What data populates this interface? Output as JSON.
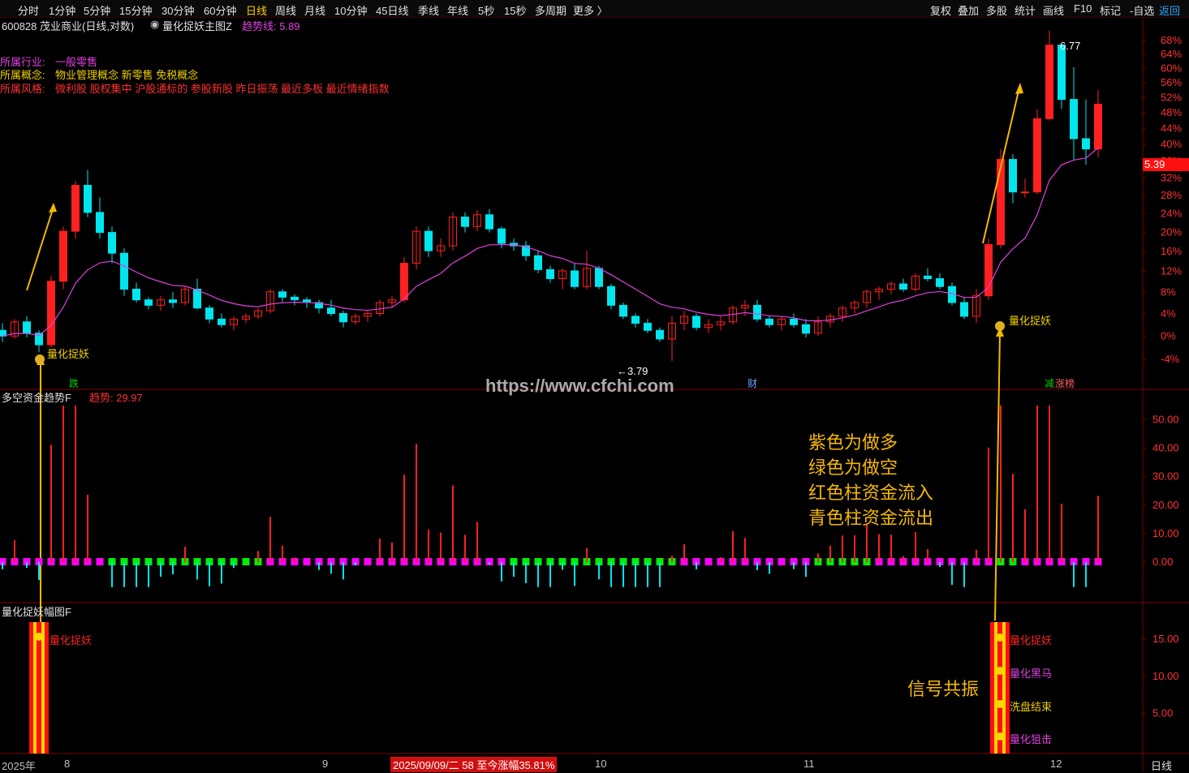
{
  "periods": [
    {
      "label": "分时",
      "active": false
    },
    {
      "label": "1分钟",
      "active": false
    },
    {
      "label": "5分钟",
      "active": false
    },
    {
      "label": "15分钟",
      "active": false
    },
    {
      "label": "30分钟",
      "active": false
    },
    {
      "label": "60分钟",
      "active": false
    },
    {
      "label": "日线",
      "active": true
    },
    {
      "label": "周线",
      "active": false
    },
    {
      "label": "月线",
      "active": false
    },
    {
      "label": "10分钟",
      "active": false
    },
    {
      "label": "45日线",
      "active": false
    },
    {
      "label": "季线",
      "active": false
    },
    {
      "label": "年线",
      "active": false
    },
    {
      "label": "5秒",
      "active": false
    },
    {
      "label": "15秒",
      "active": false
    },
    {
      "label": "多周期",
      "active": false
    },
    {
      "label": "更多 〉",
      "active": false
    }
  ],
  "toolbar_right": [
    "复权",
    "叠加",
    "多股",
    "统计",
    "画线",
    "F10",
    "标记",
    "-自选",
    "返回"
  ],
  "header": {
    "stock": "600828 茂业商业(日线,对数)",
    "indicator_name": "量化捉妖主图Z",
    "trend_label": "趋势线: 5.89"
  },
  "stock_info": {
    "industry_label": "所属行业:",
    "industry": "一般零售",
    "concept_label": "所属概念:",
    "concept": "物业管理概念 新零售 免税概念",
    "style_label": "所属风格:",
    "style": "微利股 股权集中 沪股通标的 参股新股 昨日振荡 最近多板 最近情绪指数"
  },
  "panel2": {
    "name": "多空资金趋势F",
    "value_label": "趋势: 29.97"
  },
  "panel3": {
    "name": "量化捉妖幅图F"
  },
  "annotations": {
    "signal_label": "量化捉妖",
    "high_label": "6.77",
    "low_label": "←3.79",
    "price_tag": "5.39",
    "watermark": "https://www.cfchi.com",
    "markers": [
      "跌",
      "财",
      "减",
      "涨榜"
    ],
    "legend_lines": [
      "紫色为做多",
      "绿色为做空",
      "红色柱资金流入",
      "青色柱资金流出"
    ],
    "resonance": "信号共振",
    "panel3_signals": [
      "量化捉妖",
      "量化黑马",
      "洗盘结束",
      "量化狙击"
    ]
  },
  "bottom_axis": {
    "labels": [
      "2025年",
      "8",
      "9",
      "10",
      "11",
      "12"
    ],
    "status": "2025/09/09/二 58 至今涨幅35.81%",
    "period": "日线"
  },
  "yaxis_main": [
    "68%",
    "64%",
    "60%",
    "56%",
    "52%",
    "48%",
    "44%",
    "40%",
    "36%",
    "32%",
    "28%",
    "24%",
    "20%",
    "16%",
    "12%",
    "8%",
    "4%",
    "0%",
    "-4%"
  ],
  "yaxis_p2": [
    "50.00",
    "40.00",
    "30.00",
    "20.00",
    "10.00",
    "0.00"
  ],
  "yaxis_p3": [
    "15.00",
    "10.00",
    "5.00"
  ],
  "colors": {
    "up": "#ff2020",
    "down": "#00e5ee",
    "trend": "#e040e0",
    "long": "#ff00ff",
    "short": "#00ee00",
    "grid": "#800000",
    "yellow": "#ffd700"
  },
  "chart_data": {
    "type": "candlestick",
    "x": [],
    "candles": [
      [
        4.0,
        4.05,
        3.92,
        3.96
      ],
      [
        3.96,
        4.08,
        3.94,
        4.06
      ],
      [
        4.06,
        4.1,
        3.95,
        3.98
      ],
      [
        3.98,
        4.0,
        3.85,
        3.9
      ],
      [
        3.9,
        4.4,
        3.88,
        4.36
      ],
      [
        4.36,
        4.8,
        4.3,
        4.76
      ],
      [
        4.76,
        5.2,
        4.7,
        5.16
      ],
      [
        5.16,
        5.3,
        4.88,
        4.92
      ],
      [
        4.92,
        5.05,
        4.7,
        4.75
      ],
      [
        4.75,
        4.8,
        4.5,
        4.58
      ],
      [
        4.58,
        4.62,
        4.25,
        4.3
      ],
      [
        4.3,
        4.35,
        4.2,
        4.22
      ],
      [
        4.22,
        4.24,
        4.15,
        4.18
      ],
      [
        4.18,
        4.25,
        4.14,
        4.22
      ],
      [
        4.22,
        4.28,
        4.16,
        4.2
      ],
      [
        4.2,
        4.32,
        4.18,
        4.3
      ],
      [
        4.3,
        4.38,
        4.15,
        4.16
      ],
      [
        4.16,
        4.18,
        4.05,
        4.08
      ],
      [
        4.08,
        4.12,
        4.02,
        4.04
      ],
      [
        4.04,
        4.1,
        4.0,
        4.08
      ],
      [
        4.08,
        4.12,
        4.05,
        4.1
      ],
      [
        4.1,
        4.16,
        4.08,
        4.14
      ],
      [
        4.14,
        4.3,
        4.12,
        4.28
      ],
      [
        4.28,
        4.3,
        4.2,
        4.24
      ],
      [
        4.24,
        4.26,
        4.18,
        4.22
      ],
      [
        4.22,
        4.24,
        4.16,
        4.2
      ],
      [
        4.2,
        4.22,
        4.12,
        4.16
      ],
      [
        4.16,
        4.22,
        4.1,
        4.12
      ],
      [
        4.12,
        4.14,
        4.02,
        4.06
      ],
      [
        4.06,
        4.12,
        4.04,
        4.1
      ],
      [
        4.1,
        4.14,
        4.06,
        4.12
      ],
      [
        4.12,
        4.22,
        4.1,
        4.2
      ],
      [
        4.2,
        4.25,
        4.16,
        4.22
      ],
      [
        4.22,
        4.55,
        4.2,
        4.5
      ],
      [
        4.5,
        4.8,
        4.45,
        4.76
      ],
      [
        4.76,
        4.8,
        4.55,
        4.6
      ],
      [
        4.6,
        4.7,
        4.55,
        4.64
      ],
      [
        4.64,
        4.92,
        4.6,
        4.88
      ],
      [
        4.88,
        4.92,
        4.75,
        4.8
      ],
      [
        4.8,
        4.94,
        4.76,
        4.9
      ],
      [
        4.9,
        4.95,
        4.75,
        4.78
      ],
      [
        4.78,
        4.8,
        4.62,
        4.66
      ],
      [
        4.66,
        4.7,
        4.6,
        4.64
      ],
      [
        4.64,
        4.68,
        4.52,
        4.56
      ],
      [
        4.56,
        4.6,
        4.42,
        4.45
      ],
      [
        4.45,
        4.48,
        4.35,
        4.38
      ],
      [
        4.38,
        4.46,
        4.3,
        4.44
      ],
      [
        4.44,
        4.5,
        4.3,
        4.32
      ],
      [
        4.32,
        4.6,
        4.3,
        4.46
      ],
      [
        4.46,
        4.48,
        4.3,
        4.32
      ],
      [
        4.32,
        4.34,
        4.15,
        4.18
      ],
      [
        4.18,
        4.2,
        4.08,
        4.1
      ],
      [
        4.1,
        4.12,
        4.02,
        4.05
      ],
      [
        4.05,
        4.08,
        3.98,
        4.0
      ],
      [
        4.0,
        4.02,
        3.92,
        3.94
      ],
      [
        3.94,
        4.1,
        3.79,
        4.05
      ],
      [
        4.05,
        4.14,
        4.0,
        4.1
      ],
      [
        4.1,
        4.12,
        4.0,
        4.02
      ],
      [
        4.02,
        4.08,
        3.98,
        4.04
      ],
      [
        4.04,
        4.1,
        4.0,
        4.06
      ],
      [
        4.06,
        4.18,
        4.04,
        4.16
      ],
      [
        4.16,
        4.22,
        4.1,
        4.18
      ],
      [
        4.18,
        4.22,
        4.06,
        4.08
      ],
      [
        4.08,
        4.1,
        4.02,
        4.04
      ],
      [
        4.04,
        4.1,
        4.0,
        4.08
      ],
      [
        4.08,
        4.12,
        4.02,
        4.04
      ],
      [
        4.04,
        4.08,
        3.95,
        3.98
      ],
      [
        3.98,
        4.1,
        3.96,
        4.06
      ],
      [
        4.06,
        4.12,
        4.02,
        4.1
      ],
      [
        4.1,
        4.18,
        4.06,
        4.16
      ],
      [
        4.16,
        4.22,
        4.12,
        4.2
      ],
      [
        4.2,
        4.3,
        4.16,
        4.28
      ],
      [
        4.28,
        4.32,
        4.22,
        4.3
      ],
      [
        4.3,
        4.36,
        4.26,
        4.34
      ],
      [
        4.34,
        4.38,
        4.28,
        4.3
      ],
      [
        4.3,
        4.42,
        4.28,
        4.4
      ],
      [
        4.4,
        4.46,
        4.36,
        4.38
      ],
      [
        4.38,
        4.42,
        4.3,
        4.32
      ],
      [
        4.32,
        4.35,
        4.18,
        4.2
      ],
      [
        4.2,
        4.24,
        4.08,
        4.1
      ],
      [
        4.1,
        4.3,
        4.05,
        4.25
      ],
      [
        4.25,
        4.7,
        4.22,
        4.65
      ],
      [
        4.65,
        5.5,
        4.62,
        5.4
      ],
      [
        5.4,
        5.45,
        5.0,
        5.1
      ],
      [
        5.1,
        5.22,
        5.05,
        5.1
      ],
      [
        5.1,
        5.9,
        5.08,
        5.8
      ],
      [
        5.8,
        6.77,
        5.78,
        6.6
      ],
      [
        6.6,
        6.62,
        5.9,
        6.0
      ],
      [
        6.0,
        6.35,
        5.4,
        5.6
      ],
      [
        5.6,
        6.0,
        5.35,
        5.5
      ],
      [
        5.5,
        6.1,
        5.42,
        5.95
      ]
    ],
    "trend_values": [],
    "fund_trend": [],
    "ylim_pct": [
      -4,
      68
    ]
  }
}
